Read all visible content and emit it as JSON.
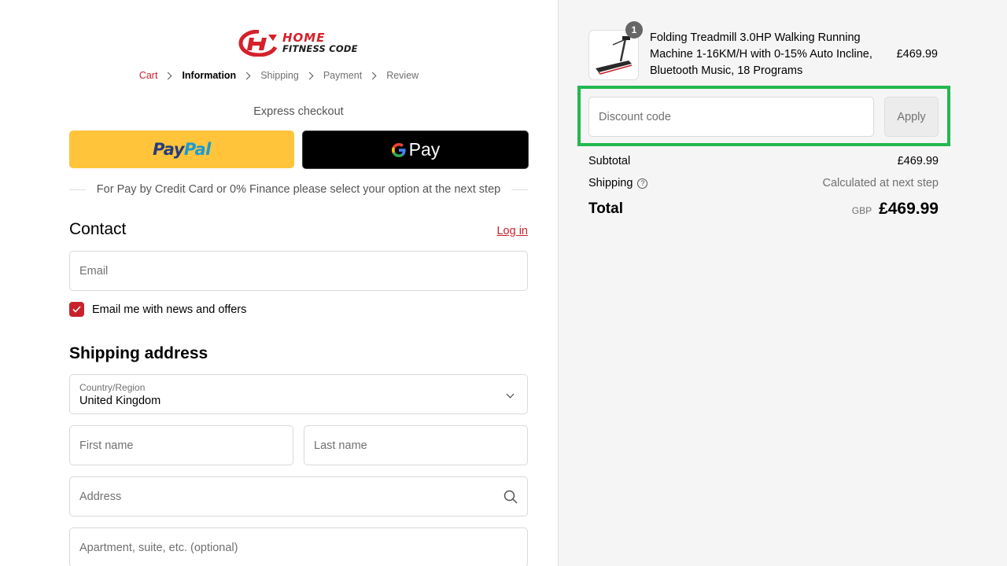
{
  "logo": {
    "line1": "HOME",
    "line2": "FITNESS CODE"
  },
  "breadcrumb": [
    "Cart",
    "Information",
    "Shipping",
    "Payment",
    "Review"
  ],
  "express": {
    "label": "Express checkout",
    "paypal_part1": "Pay",
    "paypal_part2": "Pal",
    "gpay_label": "Pay",
    "note": "For Pay by Credit Card or 0% Finance please select your option at the next step"
  },
  "contact": {
    "heading": "Contact",
    "login": "Log in",
    "email_placeholder": "Email",
    "newsletter_label": "Email me with news and offers",
    "newsletter_checked": true
  },
  "shipping": {
    "heading": "Shipping address",
    "country_label": "Country/Region",
    "country_value": "United Kingdom",
    "first_name_placeholder": "First name",
    "last_name_placeholder": "Last name",
    "address_placeholder": "Address",
    "apartment_placeholder": "Apartment, suite, etc. (optional)"
  },
  "order": {
    "item": {
      "quantity": "1",
      "title": "Folding Treadmill 3.0HP Walking Running Machine 1-16KM/H with 0-15% Auto Incline, Bluetooth Music, 18 Programs",
      "price": "£469.99"
    },
    "discount_placeholder": "Discount code",
    "apply_label": "Apply",
    "subtotal_label": "Subtotal",
    "subtotal_value": "£469.99",
    "shipping_label": "Shipping",
    "shipping_value": "Calculated at next step",
    "total_label": "Total",
    "currency": "GBP",
    "total_value": "£469.99"
  },
  "colors": {
    "accent": "#c8232c",
    "paypal_yellow": "#ffc439",
    "highlight_green": "#22b84e"
  }
}
